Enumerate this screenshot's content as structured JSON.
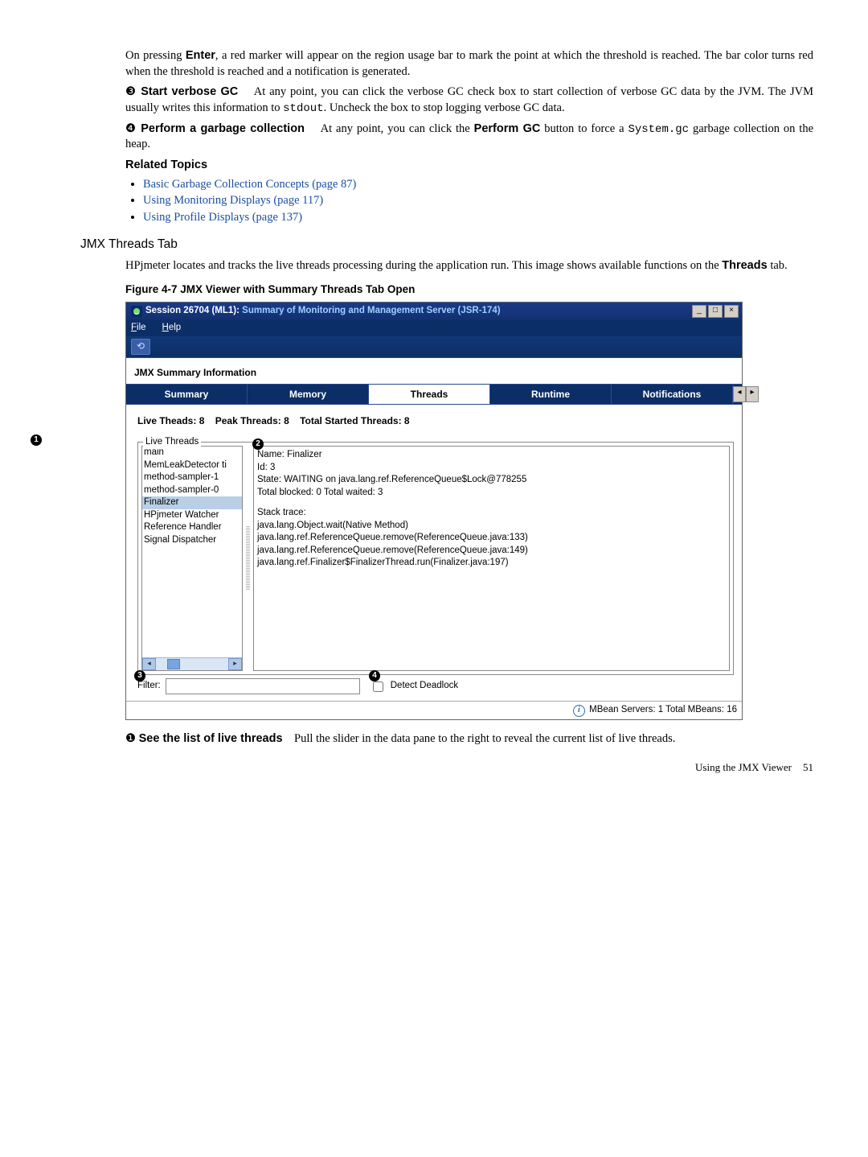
{
  "body": {
    "p1_a": "On pressing ",
    "p1_enter": "Enter",
    "p1_b": ", a red marker will appear on the region usage bar to mark the point at which the threshold is reached. The bar color turns red when the threshold is reached and a notification is generated.",
    "item3_num": "❸",
    "item3_title": "Start verbose GC",
    "item3_text_a": "At any point, you can click the verbose GC check box to start collection of verbose GC data by the JVM. The JVM usually writes this information to ",
    "item3_code": "stdout",
    "item3_text_b": ". Uncheck the box to stop logging verbose GC data.",
    "item4_num": "❹",
    "item4_title": "Perform a garbage collection",
    "item4_text_a": "At any point, you can click the ",
    "item4_bold": "Perform GC",
    "item4_text_b": " button to force a ",
    "item4_code": "System.gc",
    "item4_text_c": " garbage collection on the heap.",
    "related": "Related Topics",
    "links": [
      "Basic Garbage Collection Concepts (page 87)",
      "Using Monitoring Displays (page 117)",
      "Using Profile Displays (page 137)"
    ],
    "h3": "JMX Threads Tab",
    "h3_para_a": "HPjmeter locates and tracks the live threads processing during the application run. This image shows available functions on the ",
    "h3_para_bold": "Threads",
    "h3_para_b": " tab.",
    "fig_caption": "Figure 4-7 JMX Viewer with Summary Threads Tab Open",
    "see_num": "❶",
    "see_title": "See the list of live threads",
    "see_text": "Pull the slider in the data pane to the right to reveal the current list of live threads."
  },
  "win": {
    "title_a": "Session 26704 (ML1): ",
    "title_b": "Summary of Monitoring and Management Server (JSR-174)",
    "menu_file": "File",
    "menu_help": "Help",
    "section_title": "JMX Summary Information",
    "tabs": [
      "Summary",
      "Memory",
      "Threads",
      "Runtime",
      "Notifications"
    ],
    "stats": {
      "live": "Live Theads: 8",
      "peak": "Peak Threads: 8",
      "total": "Total Started Threads: 8"
    },
    "fs_legend": "Live Threads",
    "threads": [
      "main",
      "MemLeakDetector ti",
      "method-sampler-1",
      "method-sampler-0",
      "Finalizer",
      "HPjmeter Watcher",
      "Reference Handler",
      "Signal Dispatcher"
    ],
    "selected_index": 4,
    "detail": {
      "name": "Name: Finalizer",
      "id": "Id: 3",
      "state": "State: WAITING on java.lang.ref.ReferenceQueue$Lock@778255",
      "blocked": "Total blocked: 0 Total waited: 3",
      "stack_label": "Stack trace:",
      "stack": [
        "java.lang.Object.wait(Native Method)",
        "java.lang.ref.ReferenceQueue.remove(ReferenceQueue.java:133)",
        "java.lang.ref.ReferenceQueue.remove(ReferenceQueue.java:149)",
        "java.lang.ref.Finalizer$FinalizerThread.run(Finalizer.java:197)"
      ]
    },
    "filter_label": "Filter:",
    "deadlock_label": "Detect Deadlock",
    "status": "MBean Servers: 1 Total MBeans: 16",
    "callouts": {
      "c1": "1",
      "c2": "2",
      "c3": "3",
      "c4": "4"
    }
  },
  "footer": {
    "title": "Using the JMX Viewer",
    "page": "51"
  }
}
